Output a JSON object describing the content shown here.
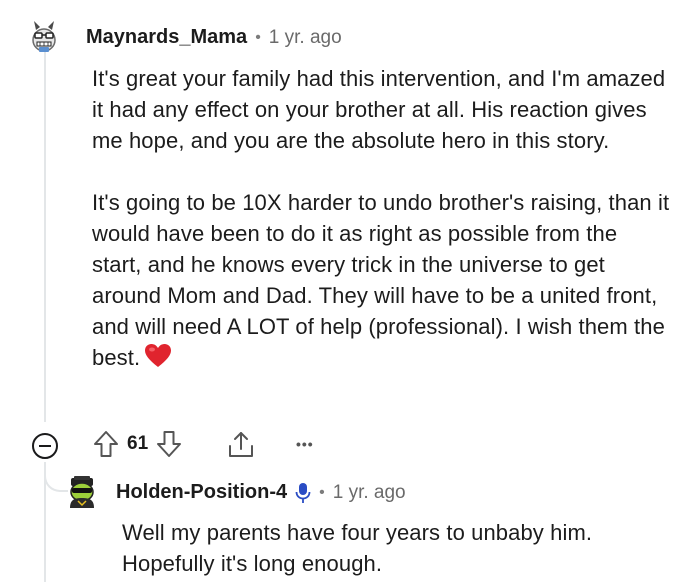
{
  "comment": {
    "username": "Maynards_Mama",
    "timestamp": "1 yr. ago",
    "paragraphs": [
      "It's great your family had this intervention, and I'm amazed it had any effect on your brother at all. His reaction gives me hope, and you are the absolute hero in this story.",
      "It's going to be 10X harder to undo brother's raising, than it would have been to do it as right as possible from the start, and he knows every trick in the universe to get around Mom and Dad. They will have to be a united front, and will need A LOT of help (professional). I wish them the best."
    ],
    "emoji": "heart-emoji",
    "score": "61",
    "more_label": "•••",
    "icons": [
      "collapse-icon",
      "upvote-icon",
      "downvote-icon",
      "share-icon",
      "more-icon"
    ]
  },
  "reply": {
    "username": "Holden-Position-4",
    "timestamp": "1 yr. ago",
    "badge_icon": "microphone-icon",
    "text": "Well my parents have four years to unbaby him. Hopefully it's long enough."
  },
  "colors": {
    "text": "#1c1c1c",
    "meta": "#6a6a6a",
    "thread_line": "#e3e6e8",
    "heart": "#e0242e",
    "mic": "#2a4cc4"
  }
}
